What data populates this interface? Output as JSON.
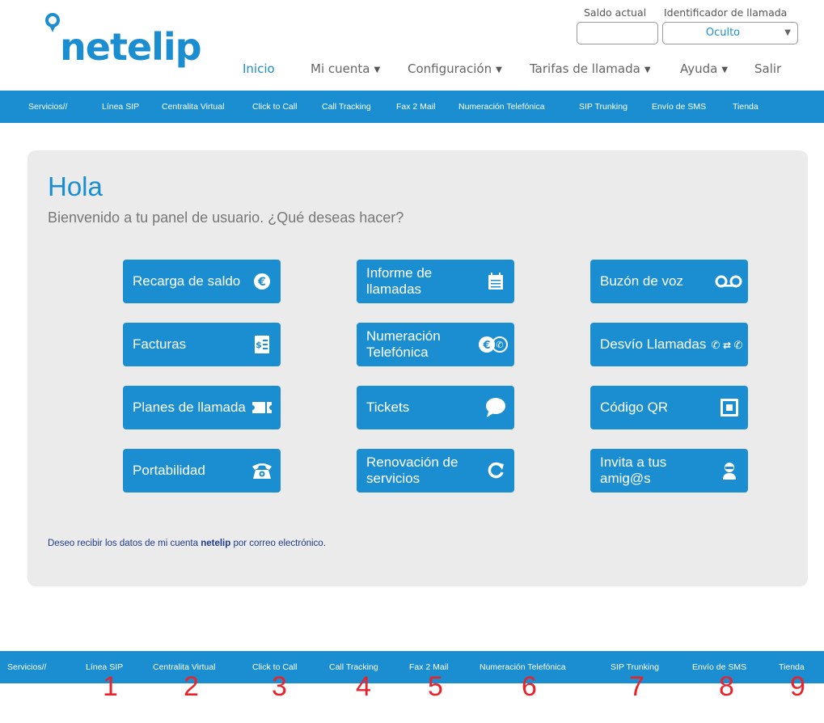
{
  "brand": {
    "name": "netelip",
    "color": "#1a8ed0"
  },
  "header": {
    "saldo_label": "Saldo actual",
    "caller_id_label": "Identificador de llamada",
    "caller_id_value": "Oculto"
  },
  "nav": {
    "items": [
      {
        "label": "Inicio",
        "active": true,
        "dropdown": false
      },
      {
        "label": "Mi cuenta",
        "dropdown": true
      },
      {
        "label": "Configuración",
        "dropdown": true
      },
      {
        "label": "Tarifas de llamada",
        "dropdown": true
      },
      {
        "label": "Ayuda",
        "dropdown": true
      },
      {
        "label": "Salir",
        "dropdown": false
      }
    ]
  },
  "services": [
    "Servicios//",
    "Línea SIP",
    "Centralita Virtual",
    "Click to Call",
    "Call Tracking",
    "Fax 2 Mail",
    "Numeración Telefónica",
    "SIP Trunking",
    "Envío de SMS",
    "Tienda"
  ],
  "panel": {
    "greeting": "Hola",
    "welcome": "Bienvenido a tu panel de usuario. ¿Qué deseas hacer?",
    "footer_prefix": "Deseo recibir los datos de mi cuenta ",
    "footer_brand": "netelip",
    "footer_suffix": " por correo electrónico."
  },
  "tiles": [
    {
      "label": "Recarga de saldo",
      "icon": "euro-icon"
    },
    {
      "label": "Informe de llamadas",
      "icon": "calendar-icon"
    },
    {
      "label": "Buzón de voz",
      "icon": "voicemail-icon"
    },
    {
      "label": "Facturas",
      "icon": "invoice-icon"
    },
    {
      "label": "Numeración Telefónica",
      "icon": "euro-phone-icon"
    },
    {
      "label": "Desvío Llamadas",
      "icon": "call-forward-icon"
    },
    {
      "label": "Planes de llamada",
      "icon": "ticket-icon"
    },
    {
      "label": "Tickets",
      "icon": "chat-bubble-icon"
    },
    {
      "label": "Código QR",
      "icon": "qr-icon"
    },
    {
      "label": "Portabilidad",
      "icon": "telephone-icon"
    },
    {
      "label": "Renovación de servicios",
      "icon": "refresh-icon"
    },
    {
      "label": "Invita a tus amig@s",
      "icon": "user-icon"
    }
  ],
  "numbers": [
    "1",
    "2",
    "3",
    "4",
    "5",
    "6",
    "7",
    "8",
    "9"
  ]
}
